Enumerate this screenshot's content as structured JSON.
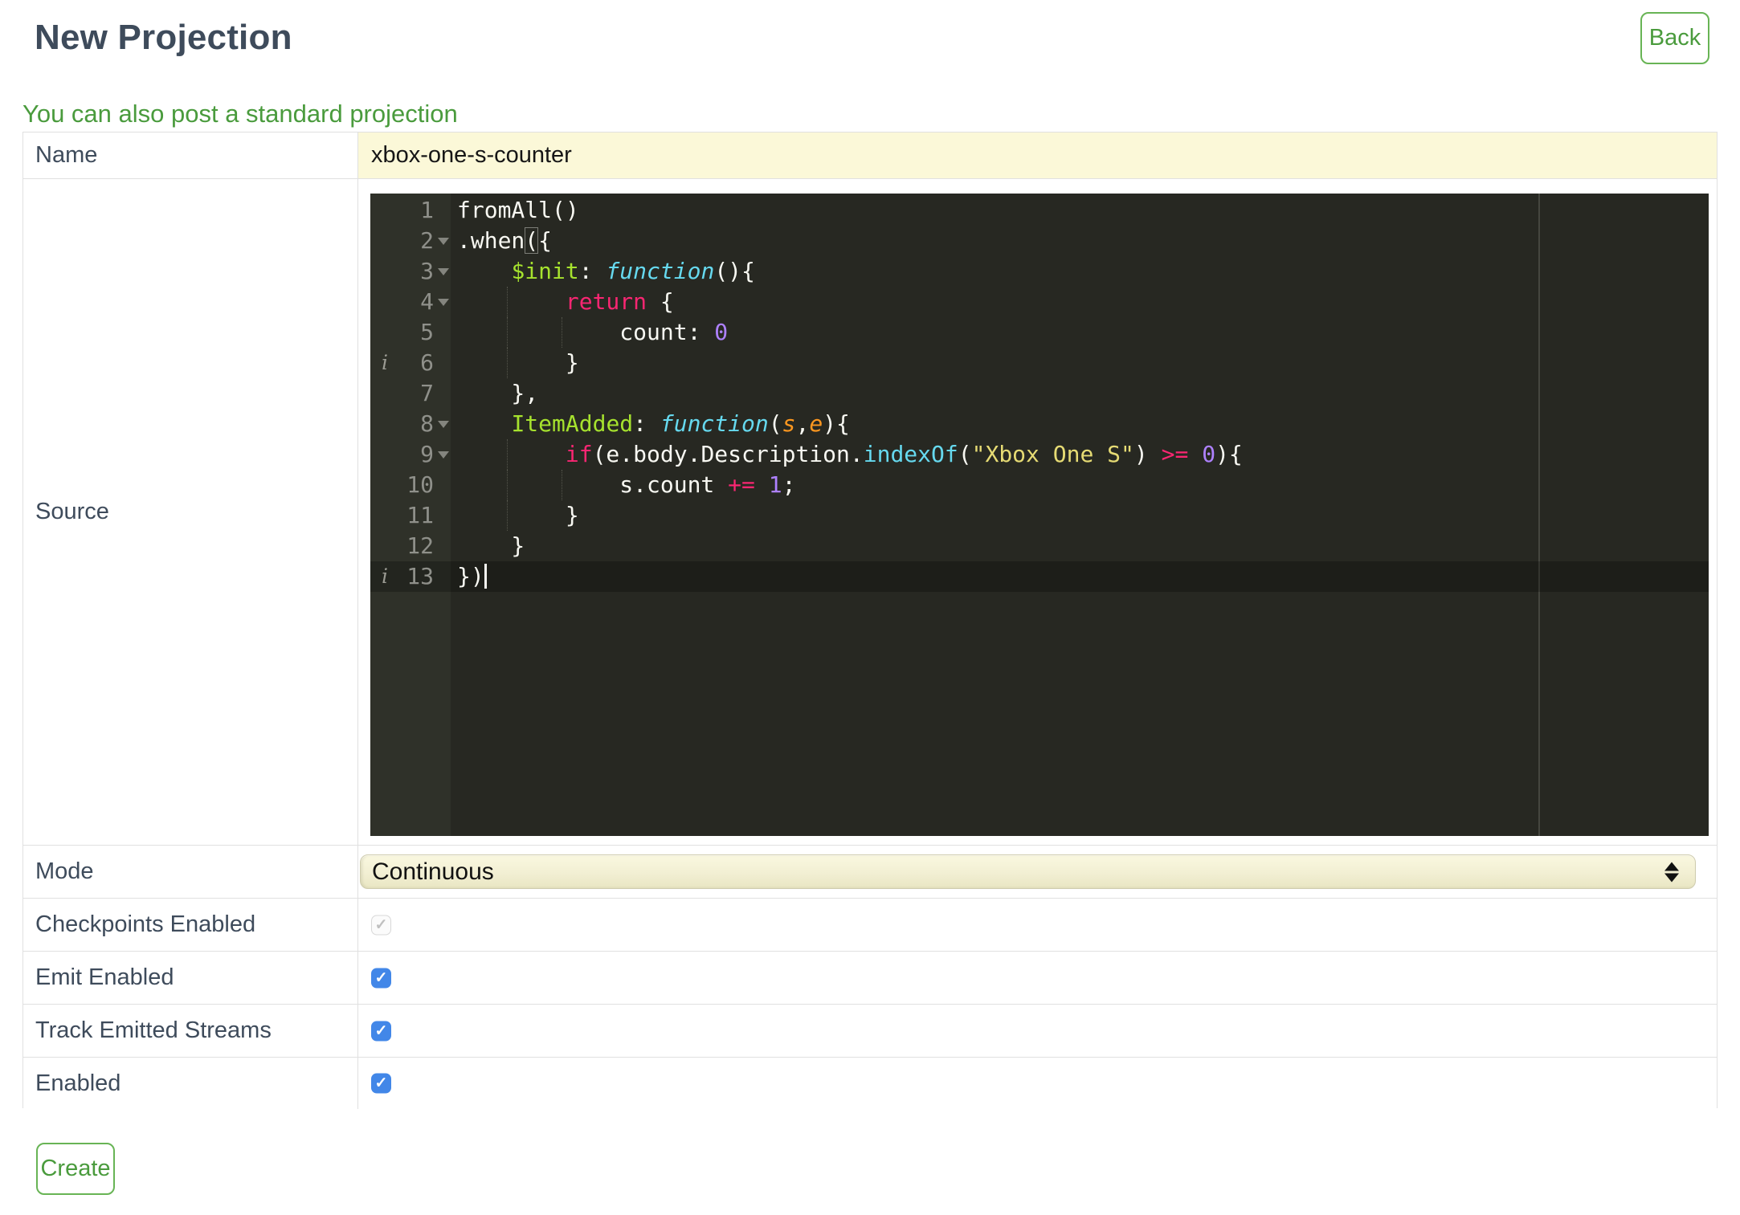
{
  "header": {
    "title": "New Projection",
    "back_label": "Back"
  },
  "info_link": {
    "text": "You can also post a standard projection"
  },
  "form": {
    "name": {
      "label": "Name",
      "value": "xbox-one-s-counter"
    },
    "source": {
      "label": "Source"
    },
    "mode": {
      "label": "Mode",
      "value": "Continuous"
    },
    "checkboxes": [
      {
        "label": "Checkpoints Enabled",
        "checked": true,
        "disabled": true
      },
      {
        "label": "Emit Enabled",
        "checked": true,
        "disabled": false
      },
      {
        "label": "Track Emitted Streams",
        "checked": true,
        "disabled": false
      },
      {
        "label": "Enabled",
        "checked": true,
        "disabled": false
      }
    ],
    "create_label": "Create",
    "check_glyph": "✓"
  },
  "colors": {
    "accent_green": "#4a9b3d",
    "green_border": "#68b455",
    "title_text": "#3e4b5b",
    "table_border": "#e0e0e0",
    "name_field_bg": "#fbf8d8",
    "checkbox_blue": "#4287e8",
    "editor_bg": "#272822",
    "editor_gutter_bg": "#2f3129",
    "token_keyword": "#f92672",
    "token_function": "#66d9ef",
    "token_entity": "#a6e22e",
    "token_param": "#fd971f",
    "token_number": "#ae81ff",
    "token_string": "#e6db74"
  },
  "editor": {
    "annotation_glyph": "i",
    "lines": [
      {
        "num": "1",
        "fold": false,
        "ann": false,
        "active": false,
        "guides": [],
        "tokens": [
          [
            "w",
            "fromAll()"
          ]
        ]
      },
      {
        "num": "2",
        "fold": true,
        "ann": false,
        "active": false,
        "guides": [],
        "tokens": [
          [
            "w",
            ".when"
          ],
          [
            "hb",
            "("
          ],
          [
            "w",
            "{"
          ]
        ]
      },
      {
        "num": "3",
        "fold": true,
        "ann": false,
        "active": false,
        "guides": [],
        "tokens": [
          [
            "w",
            "    "
          ],
          [
            "g",
            "$init"
          ],
          [
            "w",
            ": "
          ],
          [
            "f",
            "function"
          ],
          [
            "w",
            "(){"
          ]
        ]
      },
      {
        "num": "4",
        "fold": true,
        "ann": false,
        "active": false,
        "guides": [
          4
        ],
        "tokens": [
          [
            "w",
            "        "
          ],
          [
            "k",
            "return"
          ],
          [
            "w",
            " {"
          ]
        ]
      },
      {
        "num": "5",
        "fold": false,
        "ann": false,
        "active": false,
        "guides": [
          4,
          8
        ],
        "tokens": [
          [
            "w",
            "            count: "
          ],
          [
            "n",
            "0"
          ]
        ]
      },
      {
        "num": "6",
        "fold": false,
        "ann": true,
        "active": false,
        "guides": [
          4
        ],
        "tokens": [
          [
            "w",
            "        }"
          ]
        ]
      },
      {
        "num": "7",
        "fold": false,
        "ann": false,
        "active": false,
        "guides": [],
        "tokens": [
          [
            "w",
            "    },"
          ]
        ]
      },
      {
        "num": "8",
        "fold": true,
        "ann": false,
        "active": false,
        "guides": [],
        "tokens": [
          [
            "w",
            "    "
          ],
          [
            "g",
            "ItemAdded"
          ],
          [
            "w",
            ": "
          ],
          [
            "f",
            "function"
          ],
          [
            "w",
            "("
          ],
          [
            "o",
            "s"
          ],
          [
            "w",
            ","
          ],
          [
            "o",
            "e"
          ],
          [
            "w",
            "){"
          ]
        ]
      },
      {
        "num": "9",
        "fold": true,
        "ann": false,
        "active": false,
        "guides": [
          4
        ],
        "tokens": [
          [
            "w",
            "        "
          ],
          [
            "k",
            "if"
          ],
          [
            "w",
            "(e.body.Description."
          ],
          [
            "c",
            "indexOf"
          ],
          [
            "w",
            "("
          ],
          [
            "s",
            "\"Xbox One S\""
          ],
          [
            "w",
            ") "
          ],
          [
            "k",
            ">="
          ],
          [
            "w",
            " "
          ],
          [
            "n",
            "0"
          ],
          [
            "w",
            "){"
          ]
        ]
      },
      {
        "num": "10",
        "fold": false,
        "ann": false,
        "active": false,
        "guides": [
          4,
          8
        ],
        "tokens": [
          [
            "w",
            "            s.count "
          ],
          [
            "k",
            "+="
          ],
          [
            "w",
            " "
          ],
          [
            "n",
            "1"
          ],
          [
            "w",
            ";"
          ]
        ]
      },
      {
        "num": "11",
        "fold": false,
        "ann": false,
        "active": false,
        "guides": [
          4
        ],
        "tokens": [
          [
            "w",
            "        }"
          ]
        ]
      },
      {
        "num": "12",
        "fold": false,
        "ann": false,
        "active": false,
        "guides": [],
        "tokens": [
          [
            "w",
            "    }"
          ]
        ]
      },
      {
        "num": "13",
        "fold": false,
        "ann": true,
        "active": true,
        "guides": [],
        "cursor": true,
        "tokens": [
          [
            "w",
            "})"
          ]
        ]
      }
    ]
  }
}
